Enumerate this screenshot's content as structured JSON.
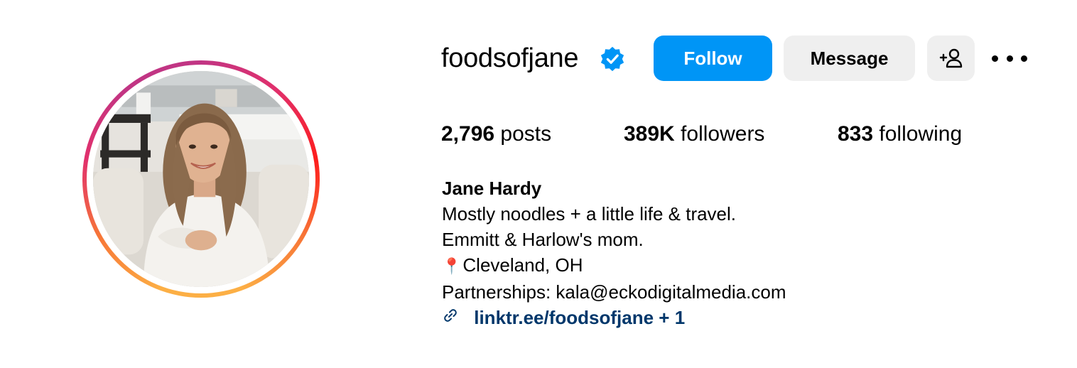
{
  "profile": {
    "username": "foodsofjane",
    "verified_icon": "verified-badge-icon",
    "buttons": {
      "follow": "Follow",
      "message": "Message",
      "add_user_icon": "add-person-icon",
      "more_icon": "more-dots-icon"
    },
    "stats": {
      "posts_count": "2,796",
      "posts_label": " posts",
      "followers_count": "389K",
      "followers_label": " followers",
      "following_count": "833",
      "following_label": " following"
    },
    "bio": {
      "full_name": "Jane Hardy",
      "lines": [
        "Mostly noodles + a little life & travel.",
        "Emmitt & Harlow's mom.",
        "Cleveland, OH",
        "Partnerships: kala@eckodigitalmedia.com"
      ],
      "location_pin": "📍",
      "link_icon": "link-chain-icon",
      "link_text": "linktr.ee/foodsofjane + 1"
    }
  },
  "colors": {
    "follow_button": "#0095f6",
    "secondary_button": "#efefef",
    "link_text": "#00376b",
    "verified_badge": "#0095f6"
  }
}
